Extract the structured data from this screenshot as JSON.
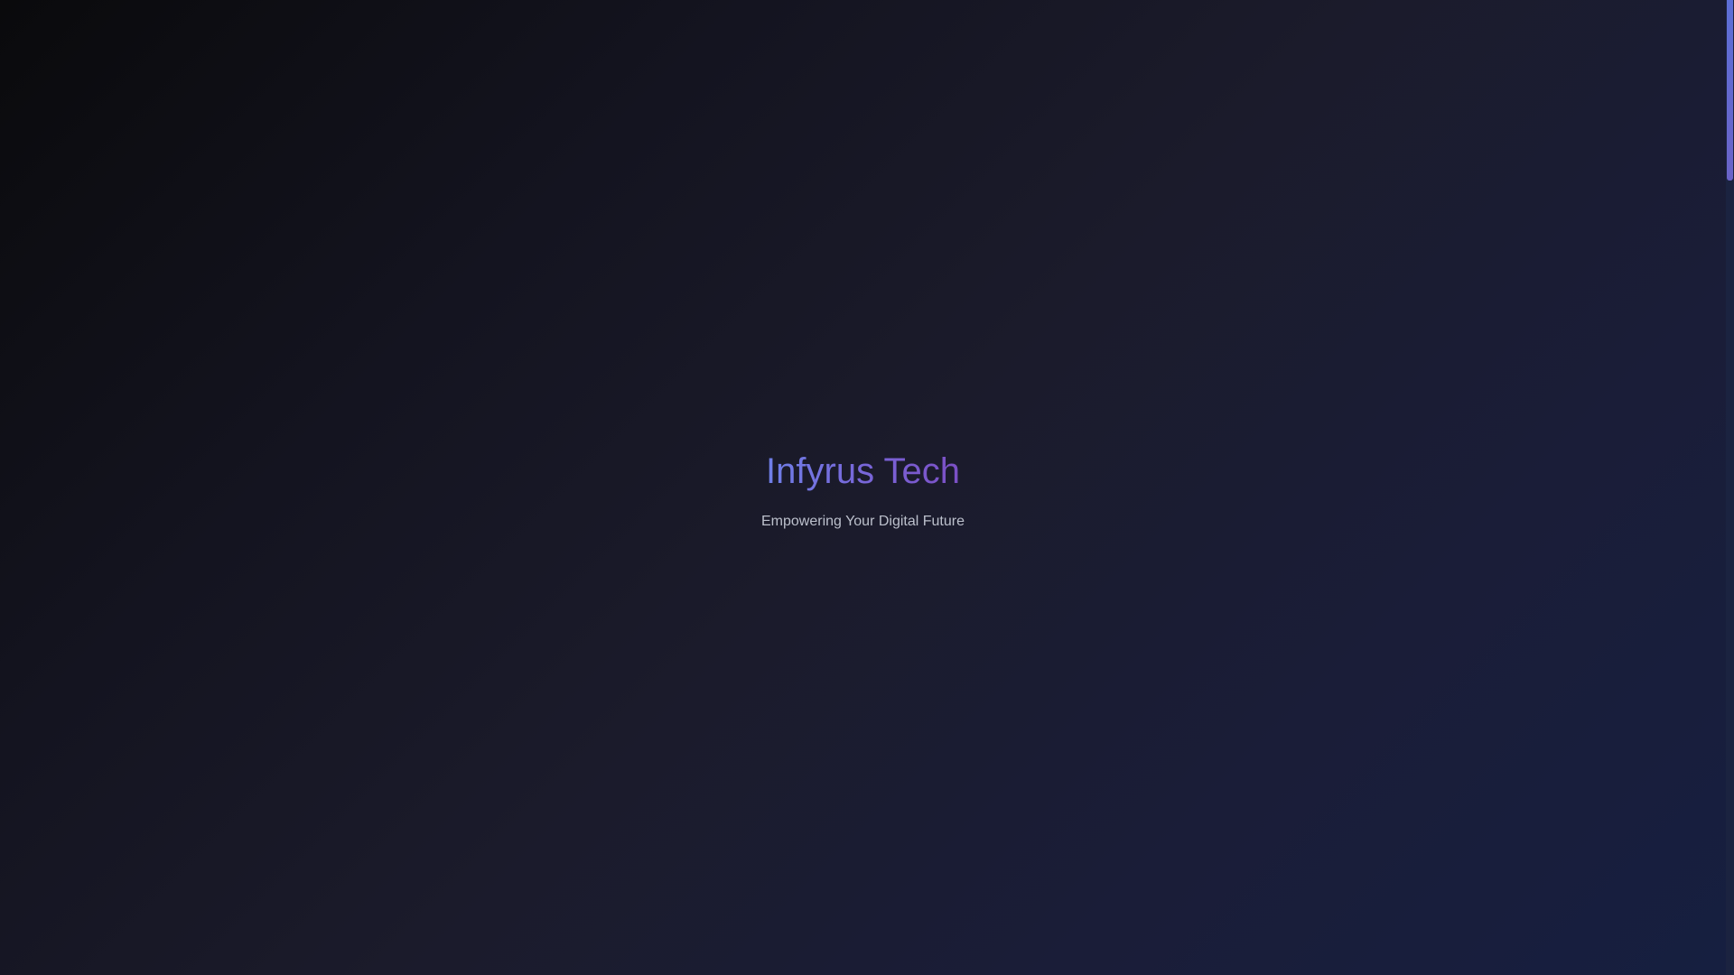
{
  "hero": {
    "title": "Infyrus Tech",
    "tagline": "Empowering Your Digital Future"
  },
  "colors": {
    "title_gradient_start": "#6f7fe8",
    "title_gradient_end": "#7b4fc4",
    "tagline": "#bcc0cc",
    "background_dark": "#0a0a0c",
    "background_navy": "#161f40",
    "scrollbar_thumb": "#5d6fd6"
  }
}
